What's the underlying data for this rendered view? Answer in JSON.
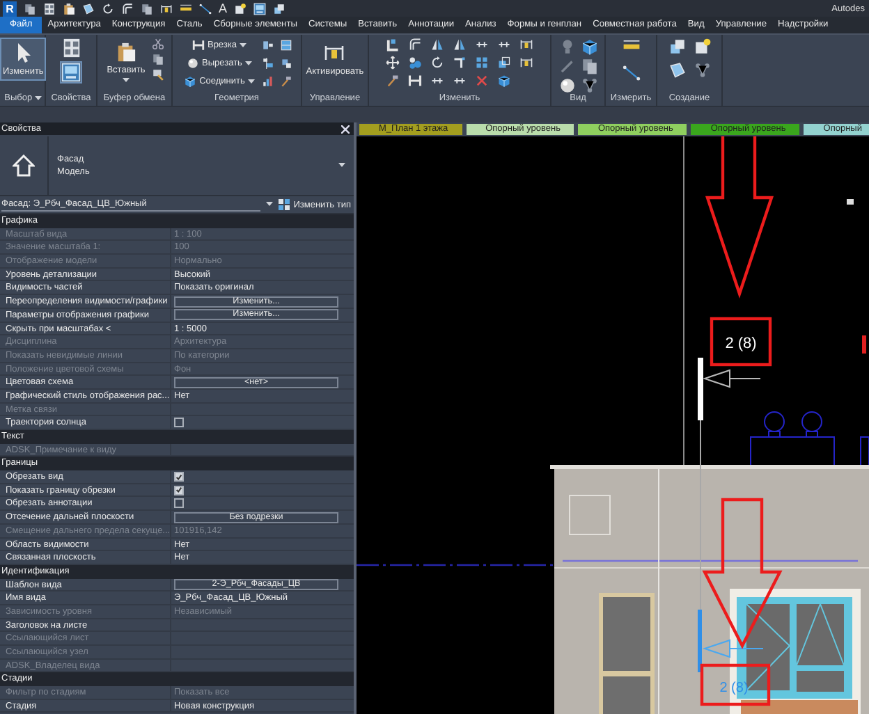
{
  "quick_access": {
    "logo": "R",
    "text_tool_glyph": "A",
    "app_title": "Autodes"
  },
  "menu_tabs": [
    {
      "label": "Файл",
      "selected": true
    },
    {
      "label": "Архитектура",
      "selected": false
    },
    {
      "label": "Конструкция",
      "selected": false
    },
    {
      "label": "Сталь",
      "selected": false
    },
    {
      "label": "Сборные элементы",
      "selected": false
    },
    {
      "label": "Системы",
      "selected": false
    },
    {
      "label": "Вставить",
      "selected": false
    },
    {
      "label": "Аннотации",
      "selected": false
    },
    {
      "label": "Анализ",
      "selected": false
    },
    {
      "label": "Формы и генплан",
      "selected": false
    },
    {
      "label": "Совместная работа",
      "selected": false
    },
    {
      "label": "Вид",
      "selected": false
    },
    {
      "label": "Управление",
      "selected": false
    },
    {
      "label": "Надстройки",
      "selected": false
    }
  ],
  "ribbon": {
    "panels": [
      {
        "label": "Выбор",
        "has_menu": true,
        "tools": [
          {
            "label": "Изменить",
            "selected": true
          }
        ]
      },
      {
        "label": "Свойства"
      },
      {
        "label": "Буфер обмена",
        "tools": [
          {
            "label": "Вставить",
            "selected": false
          }
        ]
      },
      {
        "label": "Геометрия",
        "tools": [
          {
            "label": "Врезка",
            "selected": false
          },
          {
            "label": "Вырезать",
            "selected": false
          },
          {
            "label": "Соединить",
            "selected": false
          }
        ]
      },
      {
        "label": "Управление",
        "tools": [
          {
            "label": "Активировать",
            "selected": false
          }
        ]
      },
      {
        "label": "Изменить"
      },
      {
        "label": "Вид"
      },
      {
        "label": "Измерить"
      },
      {
        "label": "Создание"
      }
    ]
  },
  "properties": {
    "title": "Свойства",
    "type_family": "Фасад",
    "type_name": "Модель",
    "instance": "Фасад: Э_Рбч_Фасад_ЦВ_Южный",
    "edit_type": "Изменить тип",
    "sections": [
      {
        "title": "Графика",
        "rows": [
          {
            "label": "Масштаб вида",
            "value": "1 : 100",
            "kind": "text",
            "disabled": true
          },
          {
            "label": "Значение масштаба    1:",
            "value": "100",
            "kind": "text",
            "disabled": true
          },
          {
            "label": "Отображение модели",
            "value": "Нормально",
            "kind": "text",
            "disabled": true
          },
          {
            "label": "Уровень детализации",
            "value": "Высокий",
            "kind": "text",
            "disabled": false
          },
          {
            "label": "Видимость частей",
            "value": "Показать оригинал",
            "kind": "text",
            "disabled": false
          },
          {
            "label": "Переопределения видимости/графики",
            "value": "Изменить...",
            "kind": "button",
            "disabled": false
          },
          {
            "label": "Параметры отображения графики",
            "value": "Изменить...",
            "kind": "button",
            "disabled": false
          },
          {
            "label": "Скрыть при масштабах <",
            "value": "1 : 5000",
            "kind": "text",
            "disabled": false
          },
          {
            "label": "Дисциплина",
            "value": "Архитектура",
            "kind": "text",
            "disabled": true
          },
          {
            "label": "Показать невидимые линии",
            "value": "По категории",
            "kind": "text",
            "disabled": true
          },
          {
            "label": "Положение цветовой схемы",
            "value": "Фон",
            "kind": "text",
            "disabled": true
          },
          {
            "label": "Цветовая схема",
            "value": "<нет>",
            "kind": "button",
            "disabled": false
          },
          {
            "label": "Графический стиль отображения рас...",
            "value": "Нет",
            "kind": "text",
            "disabled": false
          },
          {
            "label": "Метка связи",
            "kind": "text",
            "disabled": true
          },
          {
            "label": "Траектория солнца",
            "kind": "checkbox",
            "checked": false,
            "disabled": false
          }
        ]
      },
      {
        "title": "Текст",
        "rows": [
          {
            "label": "ADSK_Примечание к виду",
            "kind": "text",
            "disabled": true
          }
        ]
      },
      {
        "title": "Границы",
        "rows": [
          {
            "label": "Обрезать вид",
            "kind": "checkbox",
            "checked": true,
            "disabled": false
          },
          {
            "label": "Показать границу обрезки",
            "kind": "checkbox",
            "checked": true,
            "disabled": false
          },
          {
            "label": "Обрезать аннотации",
            "kind": "checkbox",
            "checked": false,
            "disabled": false
          },
          {
            "label": "Отсечение дальней плоскости",
            "value": "Без подрезки",
            "kind": "button",
            "disabled": false
          },
          {
            "label": "Смещение дальнего предела секуще...",
            "value": "101916,142",
            "kind": "text",
            "disabled": true
          },
          {
            "label": "Область видимости",
            "value": "Нет",
            "kind": "text",
            "disabled": false
          },
          {
            "label": "Связанная плоскость",
            "value": "Нет",
            "kind": "text",
            "disabled": false
          }
        ]
      },
      {
        "title": "Идентификация",
        "rows": [
          {
            "label": "Шаблон вида",
            "value": "2-Э_Рбч_Фасады_ЦВ",
            "kind": "button",
            "disabled": false
          },
          {
            "label": "Имя вида",
            "value": "Э_Рбч_Фасад_ЦВ_Южный",
            "kind": "text",
            "disabled": false
          },
          {
            "label": "Зависимость уровня",
            "value": "Независимый",
            "kind": "text",
            "disabled": true
          },
          {
            "label": "Заголовок на листе",
            "kind": "text",
            "disabled": false
          },
          {
            "label": "Ссылающийся лист",
            "kind": "text",
            "disabled": true
          },
          {
            "label": "Ссылающийся узел",
            "kind": "text",
            "disabled": true
          },
          {
            "label": "ADSK_Владелец вида",
            "kind": "text",
            "disabled": true
          }
        ]
      },
      {
        "title": "Стадии",
        "rows": [
          {
            "label": "Фильтр по стадиям",
            "value": "Показать все",
            "kind": "text",
            "disabled": true
          },
          {
            "label": "Стадия",
            "value": "Новая конструкция",
            "kind": "text",
            "disabled": false
          }
        ]
      }
    ]
  },
  "canvas": {
    "view_tabs": [
      {
        "label": "М_План 1 этажа",
        "color": "#a39e1f"
      },
      {
        "label": "Опорный уровень",
        "color": "#b9dcab"
      },
      {
        "label": "Опорный уровень",
        "color": "#8fcf5f"
      },
      {
        "label": "Опорный уровень",
        "color": "#3aa61d"
      },
      {
        "label": "Опорный",
        "color": "#93d2cf"
      }
    ],
    "upper_tag": "2 (8)",
    "lower_tag": "2 (8)"
  }
}
